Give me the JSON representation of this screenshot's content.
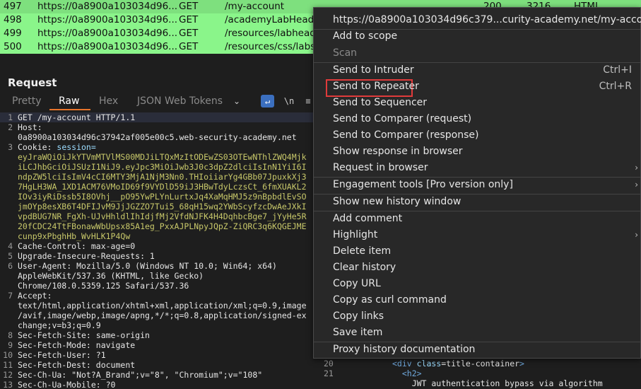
{
  "history": {
    "rows": [
      {
        "num": "497",
        "host": "https://0a8900a103034d96...",
        "method": "GET",
        "url": "/my-account",
        "status": "200",
        "length": "3216",
        "mime": "HTML"
      },
      {
        "num": "498",
        "host": "https://0a8900a103034d96...",
        "method": "GET",
        "url": "/academyLabHeader",
        "status": "",
        "length": "",
        "mime": ""
      },
      {
        "num": "499",
        "host": "https://0a8900a103034d96...",
        "method": "GET",
        "url": "/resources/labheade",
        "status": "",
        "length": "",
        "mime": ""
      },
      {
        "num": "500",
        "host": "https://0a8900a103034d96...",
        "method": "GET",
        "url": "/resources/css/labs.",
        "status": "",
        "length": "",
        "mime": ""
      }
    ]
  },
  "request": {
    "title": "Request",
    "tabs": [
      "Pretty",
      "Raw",
      "Hex",
      "JSON Web Tokens"
    ],
    "tab_chevron": "⌄",
    "wrap_icon": "↵",
    "newline_icon": "\\n",
    "menu_icon": "≡",
    "lines": [
      {
        "n": "1",
        "t": "GET /my-account HTTP/1.1"
      },
      {
        "n": "2",
        "t": "Host:"
      },
      {
        "n": "",
        "t": "0a8900a103034d96c37942af005e00c5.web-security-academy.net"
      },
      {
        "n": "3",
        "t": "Cookie: ",
        "cookie_name": "session=",
        "cookie_lines": [
          "eyJraWQiOiJkYTVmMTVlMS00MDJiLTQxMzItODEwZS03OTEwNThlZWQ4Mjk",
          "iLCJhbGciOiJSUzI1NiJ9.eyJpc3MiOiJwb3J0c3dpZ2dlciIsInN1YiI6I",
          "ndpZW5lciIsImV4cCI6MTY3MjA1NjM3Nn0.THIoiiarYg4GBb07JpuxkXj3",
          "7HgLH3WA_1XD1ACM76VMoID69f9VYDlD59iJ3HBwTdyLczsCt_6fmXUAKL2",
          "IOv3iyRiDssb5I8OVhj__pO95YwPLYnLurtxJq4XaMqHMJ5z9nBpbdlEvSO",
          "jmOYp8esXB6T4DFIJvM9JjJGZZO7Tui5_68qH15wq2YWbScyfzcDwAeJXkI",
          "vpdBUG7NR_FgXh-UJvHhldlIhIdjfMj2VfdNJFK4H4DqhbcBge7_jYyHe5R",
          "20fCDC24TtFBonawWbUpsx85A1eg_PxxAJPLNpyJQpZ-ZiQRC3q6KQGEJME",
          "cunp9xPbghHb_WvHLK1P4Qw"
        ]
      },
      {
        "n": "4",
        "t": "Cache-Control: max-age=0"
      },
      {
        "n": "5",
        "t": "Upgrade-Insecure-Requests: 1"
      },
      {
        "n": "6",
        "t": "User-Agent: Mozilla/5.0 (Windows NT 10.0; Win64; x64)"
      },
      {
        "n": "",
        "t": "AppleWebKit/537.36 (KHTML, like Gecko)"
      },
      {
        "n": "",
        "t": "Chrome/108.0.5359.125 Safari/537.36"
      },
      {
        "n": "7",
        "t": "Accept:"
      },
      {
        "n": "",
        "t": "text/html,application/xhtml+xml,application/xml;q=0.9,image"
      },
      {
        "n": "",
        "t": "/avif,image/webp,image/apng,*/*;q=0.8,application/signed-ex"
      },
      {
        "n": "",
        "t": "change;v=b3;q=0.9"
      },
      {
        "n": "8",
        "t": "Sec-Fetch-Site: same-origin"
      },
      {
        "n": "9",
        "t": "Sec-Fetch-Mode: navigate"
      },
      {
        "n": "10",
        "t": "Sec-Fetch-User: ?1"
      },
      {
        "n": "11",
        "t": "Sec-Fetch-Dest: document"
      },
      {
        "n": "12",
        "t": "Sec-Ch-Ua: \"Not?A_Brand\";v=\"8\", \"Chromium\";v=\"108\""
      },
      {
        "n": "13",
        "t": "Sec-Ch-Ua-Mobile: ?0"
      }
    ]
  },
  "response": {
    "lines": [
      {
        "n": "20",
        "tag_open": "<div ",
        "attr": "class",
        "eq": "=",
        "val": "title-container",
        "tag_close": ">"
      },
      {
        "n": "21",
        "tag_open": "  <h2",
        "attr": "",
        "eq": "",
        "val": "",
        "tag_close": ">"
      },
      {
        "n": "",
        "text": "    JWT authentication bypass via algorithm"
      }
    ]
  },
  "context_menu": {
    "header": "https://0a8900a103034d96c379...curity-academy.net/my-account",
    "add_to_scope": "Add to scope",
    "scan": "Scan",
    "send_to_intruder": "Send to Intruder",
    "send_to_intruder_shortcut": "Ctrl+I",
    "send_to_repeater": "Send to Repeater",
    "send_to_repeater_shortcut": "Ctrl+R",
    "send_to_sequencer": "Send to Sequencer",
    "send_to_comparer_request": "Send to Comparer (request)",
    "send_to_comparer_response": "Send to Comparer (response)",
    "show_response_in_browser": "Show response in browser",
    "request_in_browser": "Request in browser",
    "engagement_tools": "Engagement tools [Pro version only]",
    "show_new_history_window": "Show new history window",
    "add_comment": "Add comment",
    "highlight": "Highlight",
    "delete_item": "Delete item",
    "clear_history": "Clear history",
    "copy_url": "Copy URL",
    "copy_as_curl": "Copy as curl command",
    "copy_links": "Copy links",
    "save_item": "Save item",
    "proxy_history_documentation": "Proxy history documentation",
    "submenu_arrow": "›"
  },
  "colors": {
    "row_highlight": "#8af58a",
    "accent": "#e8742b",
    "focus_box": "#e03b3b",
    "cookie_value": "#c8c86a"
  }
}
